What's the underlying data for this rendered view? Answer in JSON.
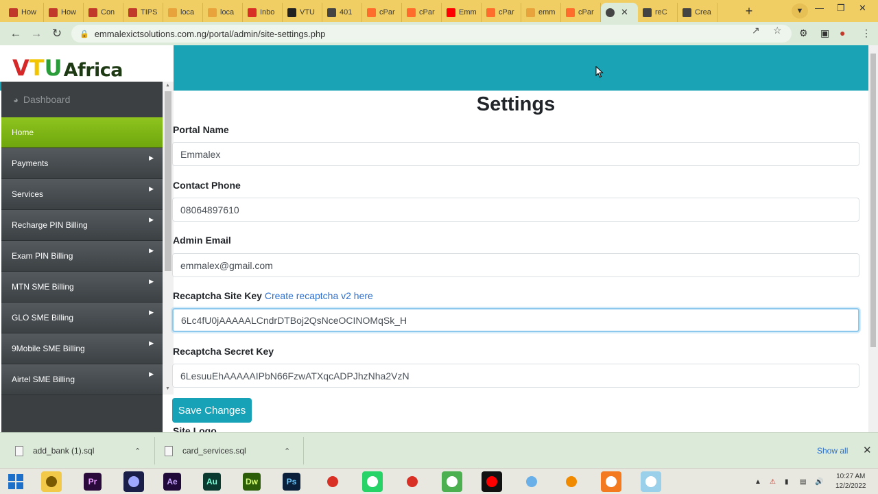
{
  "browser": {
    "tabs": [
      {
        "label": "How",
        "color": "#c0392b"
      },
      {
        "label": "How",
        "color": "#c0392b"
      },
      {
        "label": "Con",
        "color": "#c0392b"
      },
      {
        "label": "TIPS",
        "color": "#c0392b"
      },
      {
        "label": "loca",
        "color": "#e8a33d"
      },
      {
        "label": "loca",
        "color": "#e8a33d"
      },
      {
        "label": "Inbo",
        "color": "#d93025"
      },
      {
        "label": "VTU",
        "color": "#222222"
      },
      {
        "label": "401",
        "color": "#444444"
      },
      {
        "label": "cPar",
        "color": "#ff6c2c"
      },
      {
        "label": "cPar",
        "color": "#ff6c2c"
      },
      {
        "label": "Emm",
        "color": "#ff0000"
      },
      {
        "label": "cPar",
        "color": "#ff6c2c"
      },
      {
        "label": "emm",
        "color": "#e8a33d"
      },
      {
        "label": "cPar",
        "color": "#ff6c2c"
      }
    ],
    "active_tab_close": "✕",
    "trailing_tabs": [
      {
        "label": "reC",
        "color": "#444444"
      },
      {
        "label": "Crea",
        "color": "#444444"
      }
    ],
    "new_tab_label": "+",
    "url": "emmalexictsolutions.com.ng/portal/admin/site-settings.php"
  },
  "brand": {
    "v": "V",
    "t": "T",
    "u": "U",
    "name": "Africa"
  },
  "sidebar": {
    "dashboard_label": "Dashboard",
    "items": [
      {
        "label": "Home",
        "active": true
      },
      {
        "label": "Payments",
        "active": false
      },
      {
        "label": "Services",
        "active": false
      },
      {
        "label": "Recharge PIN Billing",
        "active": false
      },
      {
        "label": "Exam PIN Billing",
        "active": false
      },
      {
        "label": "MTN SME Billing",
        "active": false
      },
      {
        "label": "GLO SME Billing",
        "active": false
      },
      {
        "label": "9Mobile SME Billing",
        "active": false
      },
      {
        "label": "Airtel SME Billing",
        "active": false
      }
    ]
  },
  "settings": {
    "title": "Settings",
    "portal_name_label": "Portal Name",
    "portal_name_value": "Emmalex",
    "contact_phone_label": "Contact Phone",
    "contact_phone_value": "08064897610",
    "admin_email_label": "Admin Email",
    "admin_email_value": "emmalex@gmail.com",
    "recaptcha_site_key_label": "Recaptcha Site Key",
    "recaptcha_link_text": "Create recaptcha v2 here",
    "recaptcha_site_key_value": "6Lc4fU0jAAAAALCndrDTBoj2QsNceOCINOMqSk_H",
    "recaptcha_secret_key_label": "Recaptcha Secret Key",
    "recaptcha_secret_key_value": "6LesuuEhAAAAAIPbN66FzwATXqcADPJhzNha2VzN",
    "save_button_label": "Save Changes",
    "site_logo_label": "Site Logo"
  },
  "downloads": {
    "items": [
      {
        "filename": "add_bank (1).sql"
      },
      {
        "filename": "card_services.sql"
      }
    ],
    "show_all_label": "Show all"
  },
  "taskbar": {
    "apps": [
      {
        "name": "file-explorer",
        "label": "",
        "bg": "#f3c94a",
        "fg": "#7a5a00"
      },
      {
        "name": "premiere",
        "label": "Pr",
        "bg": "#2a0a3a",
        "fg": "#e89cff"
      },
      {
        "name": "media-encoder",
        "label": "",
        "bg": "#1a1f4a",
        "fg": "#9fa8ff"
      },
      {
        "name": "after-effects",
        "label": "Ae",
        "bg": "#1f0a3a",
        "fg": "#c9a6ff"
      },
      {
        "name": "audition",
        "label": "Au",
        "bg": "#0a3a30",
        "fg": "#7affd9"
      },
      {
        "name": "dreamweaver",
        "label": "Dw",
        "bg": "#2c5e0a",
        "fg": "#d8ff7a"
      },
      {
        "name": "photoshop",
        "label": "Ps",
        "bg": "#0a1f3a",
        "fg": "#6ac8ff"
      },
      {
        "name": "chrome",
        "label": "",
        "bg": "#e8e8e0",
        "fg": "#d93025"
      },
      {
        "name": "whatsapp",
        "label": "",
        "bg": "#25d366",
        "fg": "#ffffff"
      },
      {
        "name": "chrome-active",
        "label": "",
        "bg": "#e8e8e0",
        "fg": "#d93025"
      },
      {
        "name": "spreadsheet",
        "label": "",
        "bg": "#4caf50",
        "fg": "#ffffff"
      },
      {
        "name": "recorder",
        "label": "",
        "bg": "#111111",
        "fg": "#ff0000"
      },
      {
        "name": "paint",
        "label": "",
        "bg": "#e8e8e0",
        "fg": "#6ab0e8"
      },
      {
        "name": "vlc",
        "label": "",
        "bg": "#e8e8e0",
        "fg": "#f08a00"
      },
      {
        "name": "xampp",
        "label": "",
        "bg": "#f47a20",
        "fg": "#ffffff"
      },
      {
        "name": "notepad",
        "label": "",
        "bg": "#9ad0ea",
        "fg": "#ffffff"
      }
    ],
    "time": "10:27 AM",
    "date": "12/2/2022"
  }
}
